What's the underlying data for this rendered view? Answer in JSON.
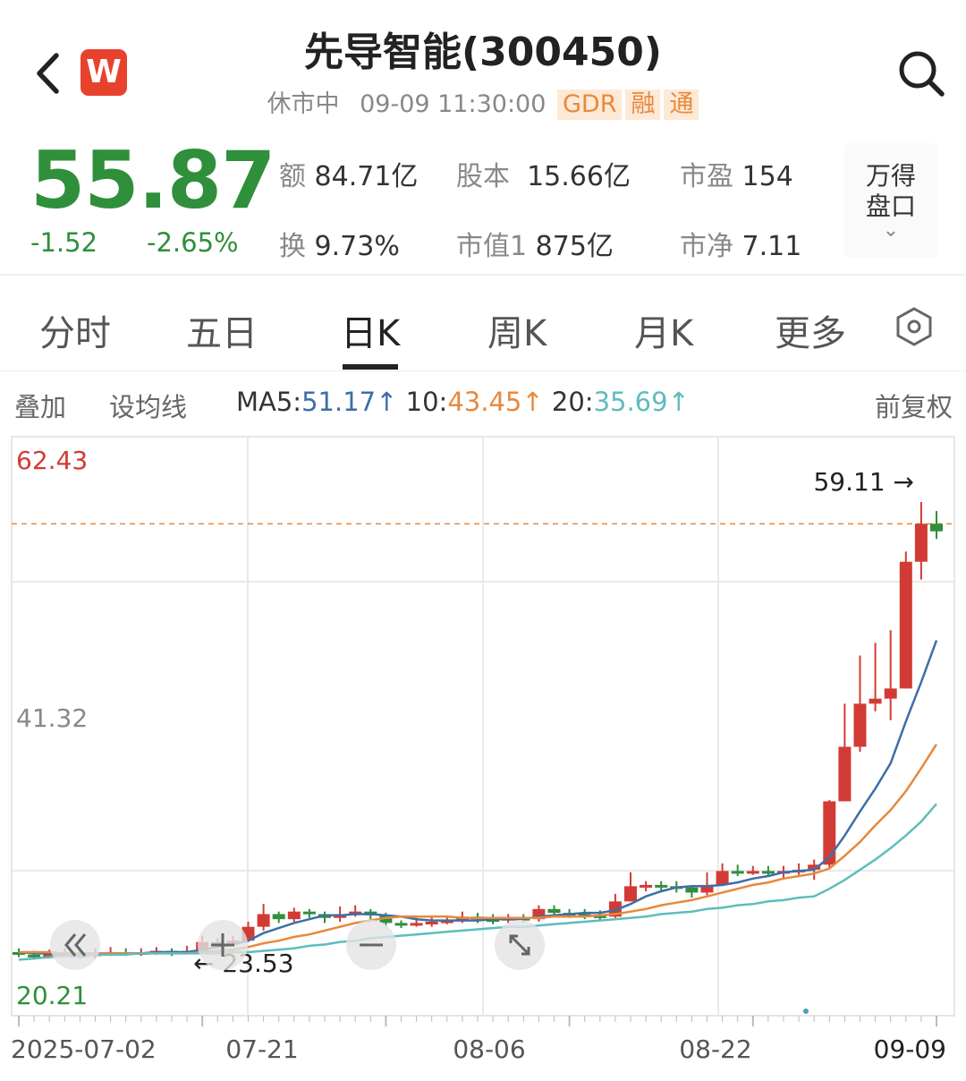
{
  "header": {
    "title": "先导智能(300450)",
    "status": "休市中",
    "datetime": "09-09 11:30:00",
    "tags": [
      "GDR",
      "融",
      "通"
    ],
    "logo_letter": "W",
    "icons": [
      "back-chevron-icon",
      "wind-logo-icon",
      "search-icon"
    ]
  },
  "quote": {
    "price": "55.87",
    "change": "-1.52",
    "change_pct": "-2.65%",
    "stats": {
      "amount": {
        "label": "额",
        "value": "84.71亿"
      },
      "share_capital": {
        "label": "股本",
        "value": "15.66亿"
      },
      "pe": {
        "label": "市盈",
        "value": "154"
      },
      "turnover": {
        "label": "换",
        "value": "9.73%"
      },
      "market_cap": {
        "label": "市值1",
        "value": "875亿"
      },
      "pb": {
        "label": "市净",
        "value": "7.11"
      }
    },
    "wind_panel": {
      "line1": "万得",
      "line2": "盘口",
      "chevron": "⌄"
    }
  },
  "tabs": [
    {
      "label": "分时",
      "active": false
    },
    {
      "label": "五日",
      "active": false
    },
    {
      "label": "日K",
      "active": true
    },
    {
      "label": "周K",
      "active": false
    },
    {
      "label": "月K",
      "active": false
    },
    {
      "label": "更多",
      "active": false
    }
  ],
  "indicators": {
    "overlay": "叠加",
    "ma_setting": "设均线",
    "ma5_label": "MA5:",
    "ma5_value": "51.17",
    "ma10_label": "10:",
    "ma10_value": "43.45",
    "ma20_label": "20:",
    "ma20_value": "35.69",
    "up_arrow": "↑",
    "adjust": "前复权"
  },
  "colors": {
    "up": "#d23b35",
    "down": "#2f8f3a",
    "ma5": "#3d6fa5",
    "ma10": "#e7893c",
    "ma20": "#5fbcbc",
    "tag_bg": "#fde9d6",
    "tag_text": "#e7893c"
  },
  "chart_data": {
    "type": "candlestick",
    "price_axis": {
      "max_label": "62.43",
      "mid_label": "41.32",
      "min_label": "20.21",
      "ylim": [
        20.21,
        62.43
      ]
    },
    "date_labels": [
      "2025-07-02",
      "07-21",
      "08-06",
      "08-22",
      "09-09"
    ],
    "high_annotation": "59.11 →",
    "low_annotation": "← 23.53",
    "reference_price": 57.39,
    "candles": [
      [
        23.6,
        23.4,
        23.9,
        23.2
      ],
      [
        23.4,
        23.2,
        23.7,
        23.0
      ],
      [
        23.2,
        23.5,
        23.8,
        23.1
      ],
      [
        23.5,
        23.4,
        23.9,
        23.2
      ],
      [
        23.4,
        23.3,
        23.7,
        23.1
      ],
      [
        23.3,
        23.5,
        23.9,
        23.1
      ],
      [
        23.5,
        23.6,
        24.0,
        23.3
      ],
      [
        23.6,
        23.5,
        23.9,
        23.3
      ],
      [
        23.5,
        23.6,
        23.9,
        23.3
      ],
      [
        23.6,
        23.7,
        24.0,
        23.4
      ],
      [
        23.7,
        23.5,
        23.9,
        23.3
      ],
      [
        23.5,
        23.7,
        24.1,
        23.53
      ],
      [
        23.7,
        24.4,
        24.9,
        23.6
      ],
      [
        24.4,
        24.3,
        24.7,
        24.0
      ],
      [
        24.3,
        24.5,
        24.9,
        24.1
      ],
      [
        24.5,
        25.6,
        26.0,
        24.4
      ],
      [
        25.6,
        26.6,
        27.4,
        25.3
      ],
      [
        26.6,
        26.2,
        26.8,
        25.9
      ],
      [
        26.2,
        26.8,
        27.1,
        26.0
      ],
      [
        26.8,
        26.6,
        27.0,
        26.3
      ],
      [
        26.6,
        26.3,
        26.8,
        25.9
      ],
      [
        26.3,
        26.6,
        27.2,
        26.0
      ],
      [
        26.6,
        26.8,
        27.3,
        26.4
      ],
      [
        26.8,
        26.5,
        27.0,
        26.2
      ],
      [
        26.5,
        25.9,
        26.7,
        25.6
      ],
      [
        25.9,
        25.8,
        26.1,
        25.5
      ],
      [
        25.8,
        25.9,
        26.3,
        25.6
      ],
      [
        25.9,
        26.0,
        26.4,
        25.6
      ],
      [
        26.0,
        26.1,
        26.5,
        25.8
      ],
      [
        26.1,
        26.4,
        26.8,
        25.9
      ],
      [
        26.4,
        26.2,
        26.7,
        25.9
      ],
      [
        26.2,
        26.1,
        26.6,
        25.8
      ],
      [
        26.1,
        26.3,
        26.6,
        25.9
      ],
      [
        26.3,
        26.2,
        26.6,
        25.9
      ],
      [
        26.2,
        27.0,
        27.3,
        26.0
      ],
      [
        27.0,
        26.7,
        27.3,
        26.4
      ],
      [
        26.7,
        26.6,
        27.0,
        26.3
      ],
      [
        26.6,
        26.5,
        27.0,
        26.2
      ],
      [
        26.5,
        26.4,
        26.9,
        26.1
      ],
      [
        26.4,
        27.6,
        28.2,
        26.3
      ],
      [
        27.6,
        28.8,
        29.9,
        27.6
      ],
      [
        28.8,
        28.9,
        29.2,
        28.4
      ],
      [
        28.9,
        28.8,
        29.2,
        28.4
      ],
      [
        28.8,
        28.7,
        29.2,
        28.3
      ],
      [
        28.7,
        28.3,
        28.9,
        27.9
      ],
      [
        28.3,
        28.9,
        29.9,
        28.1
      ],
      [
        28.9,
        30.0,
        30.6,
        28.8
      ],
      [
        30.0,
        29.9,
        30.5,
        29.6
      ],
      [
        29.9,
        30.0,
        30.4,
        29.7
      ],
      [
        30.0,
        29.9,
        30.4,
        29.6
      ],
      [
        29.9,
        30.0,
        30.4,
        29.4
      ],
      [
        30.0,
        30.1,
        30.6,
        29.7
      ],
      [
        30.1,
        30.5,
        30.9,
        29.3
      ],
      [
        30.5,
        35.5,
        35.6,
        30.3
      ],
      [
        35.5,
        39.8,
        43.2,
        35.5
      ],
      [
        39.8,
        43.2,
        47.0,
        39.4
      ],
      [
        43.2,
        43.6,
        48.0,
        42.6
      ],
      [
        43.6,
        44.4,
        49.0,
        41.9
      ],
      [
        44.4,
        54.4,
        55.2,
        44.4
      ],
      [
        54.4,
        57.4,
        59.11,
        53.0
      ],
      [
        57.4,
        56.8,
        58.4,
        56.2
      ]
    ],
    "ma_series": [
      {
        "name": "MA5",
        "values": [
          23.6,
          23.5,
          23.5,
          23.4,
          23.4,
          23.5,
          23.5,
          23.5,
          23.5,
          23.6,
          23.6,
          23.6,
          23.8,
          24.0,
          24.2,
          24.5,
          25.1,
          25.5,
          25.9,
          26.2,
          26.5,
          26.5,
          26.6,
          26.6,
          26.5,
          26.4,
          26.2,
          26.1,
          26.1,
          26.1,
          26.1,
          26.2,
          26.2,
          26.2,
          26.4,
          26.5,
          26.6,
          26.7,
          26.7,
          26.9,
          27.4,
          28.0,
          28.4,
          28.7,
          28.8,
          28.8,
          28.9,
          29.1,
          29.4,
          29.6,
          29.9,
          30.0,
          30.1,
          31.1,
          32.8,
          34.7,
          36.5,
          38.5,
          41.8,
          44.9,
          48.2
        ]
      },
      {
        "name": "MA10",
        "values": [
          23.6,
          23.6,
          23.6,
          23.5,
          23.5,
          23.5,
          23.5,
          23.5,
          23.5,
          23.5,
          23.5,
          23.5,
          23.6,
          23.7,
          23.8,
          24.0,
          24.3,
          24.5,
          24.8,
          25.0,
          25.3,
          25.6,
          25.9,
          26.1,
          26.3,
          26.4,
          26.4,
          26.4,
          26.4,
          26.3,
          26.3,
          26.3,
          26.3,
          26.3,
          26.3,
          26.4,
          26.4,
          26.4,
          26.5,
          26.6,
          26.8,
          27.0,
          27.3,
          27.5,
          27.7,
          28.0,
          28.3,
          28.6,
          28.9,
          29.1,
          29.4,
          29.6,
          29.8,
          30.2,
          31.2,
          32.3,
          33.6,
          34.8,
          36.3,
          38.1,
          40.0
        ]
      },
      {
        "name": "MA20",
        "values": [
          23.0,
          23.1,
          23.2,
          23.3,
          23.3,
          23.4,
          23.4,
          23.4,
          23.5,
          23.5,
          23.5,
          23.5,
          23.5,
          23.5,
          23.6,
          23.6,
          23.7,
          23.8,
          23.9,
          24.1,
          24.2,
          24.4,
          24.5,
          24.7,
          24.8,
          24.9,
          25.0,
          25.1,
          25.2,
          25.3,
          25.4,
          25.5,
          25.6,
          25.6,
          25.7,
          25.8,
          25.9,
          26.0,
          26.1,
          26.2,
          26.3,
          26.4,
          26.6,
          26.7,
          26.8,
          27.0,
          27.1,
          27.3,
          27.4,
          27.6,
          27.7,
          27.9,
          28.0,
          28.6,
          29.3,
          30.1,
          30.9,
          31.8,
          32.8,
          33.9,
          35.3
        ]
      }
    ]
  }
}
